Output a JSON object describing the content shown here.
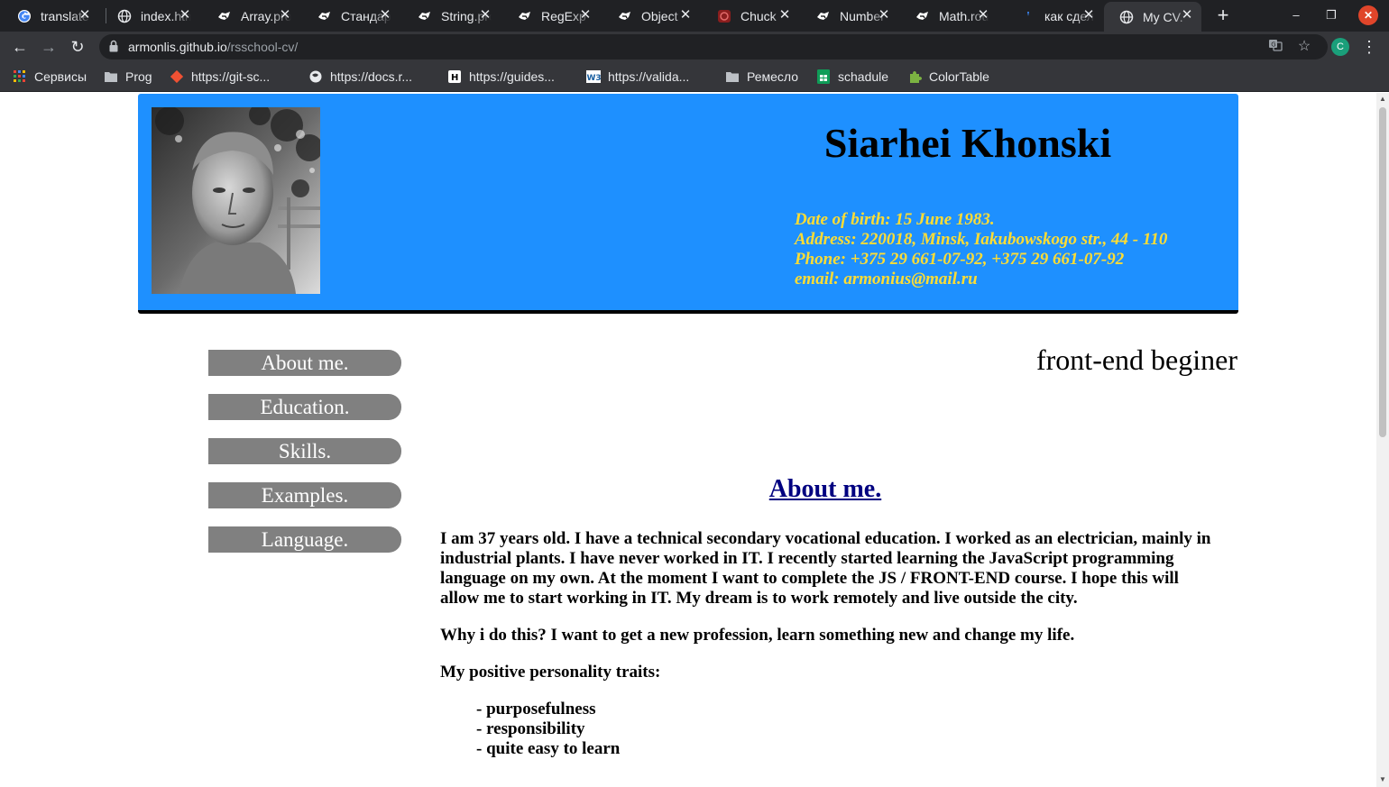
{
  "browser": {
    "tabs": [
      {
        "title": "translate",
        "icon": "google-icon"
      },
      {
        "title": "index.html",
        "icon": "globe-icon"
      },
      {
        "title": "Array.prototype",
        "icon": "mdn-icon"
      },
      {
        "title": "Стандартные",
        "icon": "mdn-icon"
      },
      {
        "title": "String.prototype",
        "icon": "mdn-icon"
      },
      {
        "title": "RegExp",
        "icon": "mdn-icon"
      },
      {
        "title": "Object",
        "icon": "mdn-icon"
      },
      {
        "title": "Chuck",
        "icon": "chuck-icon"
      },
      {
        "title": "Number",
        "icon": "mdn-icon"
      },
      {
        "title": "Math.round",
        "icon": "mdn-icon"
      },
      {
        "title": "как сделать",
        "icon": "yandex-icon"
      },
      {
        "title": "My CV.",
        "icon": "globe-icon",
        "active": true
      }
    ],
    "url_host": "armonlis.github.io",
    "url_path": "/rsschool-cv/",
    "profile_initial": "C",
    "bookmarks": [
      {
        "label": "Сервисы",
        "icon": "apps-grid-icon"
      },
      {
        "label": "Prog",
        "icon": "folder-icon"
      },
      {
        "label": "https://git-sc...",
        "icon": "git-icon"
      },
      {
        "label": "https://docs.r...",
        "icon": "globe-icon"
      },
      {
        "label": "https://guides...",
        "icon": "guides-icon"
      },
      {
        "label": "https://valida...",
        "icon": "w3c-icon"
      },
      {
        "label": "Ремесло",
        "icon": "folder-icon"
      },
      {
        "label": "schadule",
        "icon": "sheets-icon"
      },
      {
        "label": "ColorTable",
        "icon": "puzzle-icon"
      }
    ]
  },
  "page": {
    "name": "Siarhei Khonski",
    "contacts": {
      "dob": "Date of birth: 15 June 1983.",
      "address": "Address: 220018, Minsk, Iakubowskogo str., 44 - 110",
      "phone": "Phone: +375 29 661-07-92, +375 29 661-07-92",
      "email": "email: armonius@mail.ru"
    },
    "nav": [
      "About me.",
      "Education.",
      "Skills.",
      "Examples.",
      "Language."
    ],
    "role": "front-end beginer",
    "section_title": "About me.",
    "paragraphs": [
      "I am 37 years old. I have a technical secondary vocational education. I worked as an electrician, mainly in industrial plants. I have never worked in IT. I recently started learning the JavaScript programming language on my own. At the moment I want to complete the JS / FRONT-END course. I hope this will allow me to start working in IT. My dream is to work remotely and live outside the city.",
      "Why i do this? I want to get a new profession, learn something new and change my life.",
      "My positive personality traits:"
    ],
    "traits": [
      "- purposefulness",
      "- responsibility",
      "- quite easy to learn"
    ]
  },
  "colors": {
    "header_bg": "#1e90ff",
    "contacts_text": "#ffdd33",
    "nav_button_bg": "#808080",
    "section_title": "#000080"
  }
}
